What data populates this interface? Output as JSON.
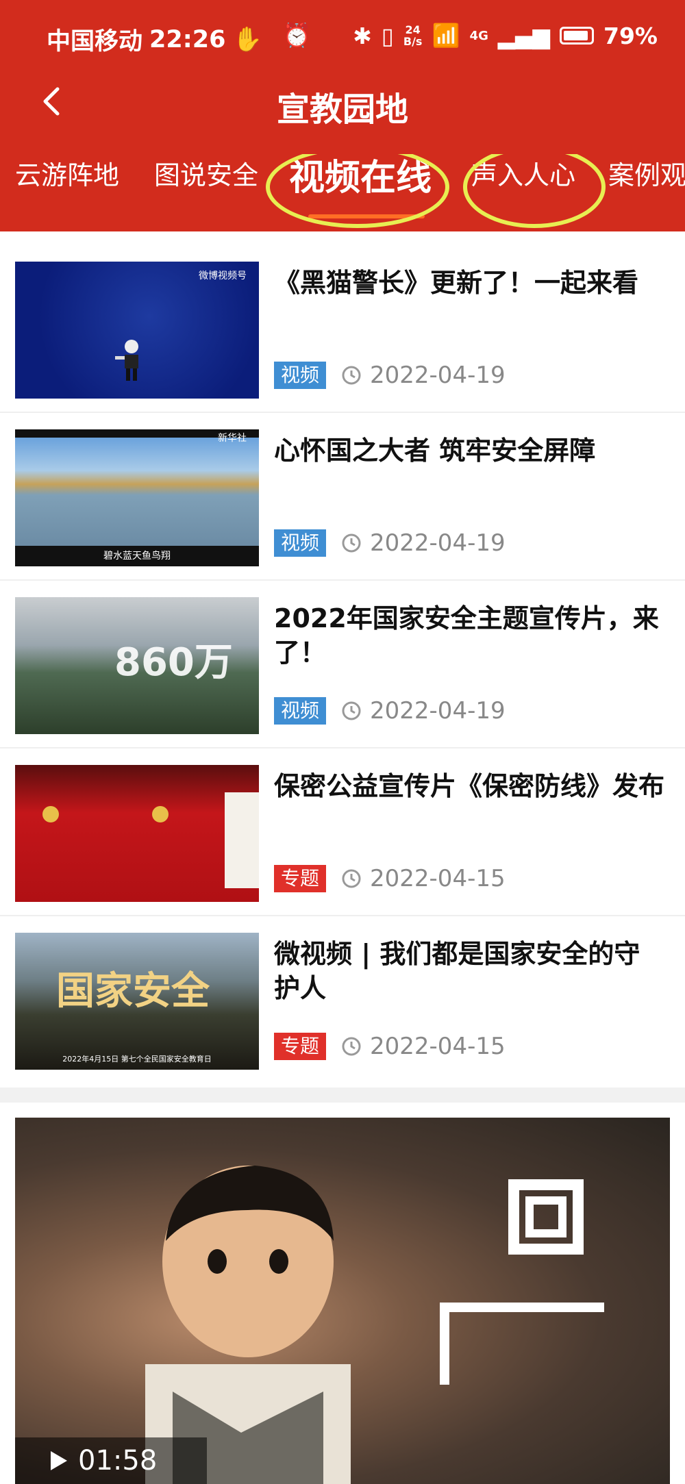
{
  "status": {
    "carrier": "中国移动",
    "time": "22:26",
    "speed_value": "24",
    "speed_unit": "B/s",
    "network": "4G",
    "battery": "79%"
  },
  "header": {
    "title": "宣教园地"
  },
  "tabs": [
    {
      "label": "云游阵地"
    },
    {
      "label": "图说安全"
    },
    {
      "label": "视频在线"
    },
    {
      "label": "声入人心"
    },
    {
      "label": "案例观"
    }
  ],
  "items": [
    {
      "title": "《黑猫警长》更新了！一起来看",
      "tag": "视频",
      "date": "2022-04-19",
      "thumb_caption": "",
      "thumb_watermark": "微博视频号"
    },
    {
      "title": "心怀国之大者 筑牢安全屏障",
      "tag": "视频",
      "date": "2022-04-19",
      "thumb_caption": "碧水蓝天鱼鸟翔",
      "thumb_watermark": "新华社"
    },
    {
      "title": "2022年国家安全主题宣传片，来了！",
      "tag": "视频",
      "date": "2022-04-19",
      "thumb_caption": "",
      "thumb_watermark": "860万"
    },
    {
      "title": "保密公益宣传片《保密防线》发布",
      "tag": "专题",
      "date": "2022-04-15",
      "thumb_caption": "",
      "thumb_watermark": ""
    },
    {
      "title": "微视频 | 我们都是国家安全的守护人",
      "tag": "专题",
      "date": "2022-04-15",
      "thumb_caption": "2022年4月15日 第七个全民国家安全教育日",
      "thumb_watermark": "国家安全"
    }
  ],
  "feature": {
    "duration": "01:58"
  },
  "colors": {
    "header_bg": "#d22c1d",
    "tag_video": "#3f8ed3",
    "tag_topic": "#e0302a",
    "tab_underline": "#ff6e25",
    "highlight_ring": "#e8ee52"
  }
}
